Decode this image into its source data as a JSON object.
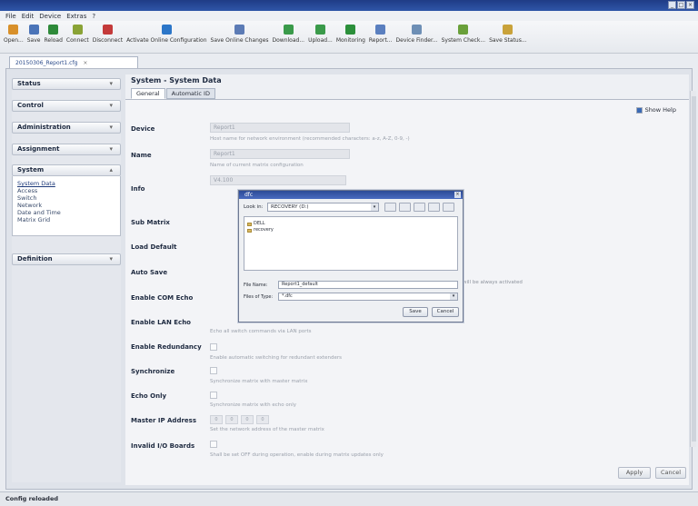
{
  "window": {
    "minimize": "_",
    "maximize": "□",
    "close": "×"
  },
  "menu": [
    "File",
    "Edit",
    "Device",
    "Extras",
    "?"
  ],
  "toolbar": [
    {
      "label": "Open...",
      "icon": "open-icon",
      "color": "#d8902a"
    },
    {
      "label": "Save",
      "icon": "save-icon",
      "color": "#4b74b8"
    },
    {
      "label": "Reload",
      "icon": "reload-icon",
      "color": "#2e8a3a"
    },
    {
      "label": "Connect",
      "icon": "connect-icon",
      "color": "#8aa336"
    },
    {
      "label": "Disconnect",
      "icon": "disconnect-icon",
      "color": "#c43a3a"
    },
    {
      "label": "Activate Online Configuration",
      "icon": "activate-icon",
      "color": "#2c76c8"
    },
    {
      "label": "Save Online Changes",
      "icon": "save-online-icon",
      "color": "#5c7bb5"
    },
    {
      "label": "Download...",
      "icon": "download-icon",
      "color": "#3a9a4a"
    },
    {
      "label": "Upload...",
      "icon": "upload-icon",
      "color": "#3a9a4a"
    },
    {
      "label": "Monitoring",
      "icon": "monitoring-icon",
      "color": "#2b8f3a"
    },
    {
      "label": "Report...",
      "icon": "report-icon",
      "color": "#5a7fbf"
    },
    {
      "label": "Device Finder...",
      "icon": "device-finder-icon",
      "color": "#6e8fb5"
    },
    {
      "label": "System Check...",
      "icon": "system-check-icon",
      "color": "#6aa03a"
    },
    {
      "label": "Save Status...",
      "icon": "save-status-icon",
      "color": "#c9a23a"
    }
  ],
  "file_tab": {
    "label": "20150306_Report1.cfg",
    "close": "×"
  },
  "sidebar": {
    "sections": [
      {
        "label": "Status",
        "chevron": "▾"
      },
      {
        "label": "Control",
        "chevron": "▾"
      },
      {
        "label": "Administration",
        "chevron": "▾"
      },
      {
        "label": "Assignment",
        "chevron": "▾"
      },
      {
        "label": "System",
        "chevron": "▴"
      },
      {
        "label": "Definition",
        "chevron": "▾"
      }
    ],
    "system_items": [
      "System Data",
      "Access",
      "Switch",
      "Network",
      "Date and Time",
      "Matrix Grid"
    ]
  },
  "main": {
    "title": "System - System Data",
    "tabs": [
      "General",
      "Automatic ID"
    ],
    "show_help": "Show Help"
  },
  "fields": {
    "device": {
      "label": "Device",
      "value": "Report1",
      "help": "Host name for network environment (recommended characters: a-z, A-Z, 0-9, -)"
    },
    "name": {
      "label": "Name",
      "value": "Report1",
      "help": "Name of current matrix configuration"
    },
    "info": {
      "label": "Info",
      "value": "V4.100"
    },
    "sub_matrix": {
      "label": "Sub Matrix"
    },
    "load_default": {
      "label": "Load Default"
    },
    "auto_save": {
      "label": "Auto Save"
    },
    "enable_com_echo": {
      "label": "Enable COM Echo"
    },
    "enable_lan_echo": {
      "label": "Enable LAN Echo",
      "help": "Echo all switch commands via LAN ports"
    },
    "enable_redundancy": {
      "label": "Enable Redundancy",
      "help": "Enable automatic switching for redundant extenders"
    },
    "synchronize": {
      "label": "Synchronize",
      "help": "Synchronize matrix with master matrix"
    },
    "echo_only": {
      "label": "Echo Only",
      "help": "Synchronize matrix with echo only"
    },
    "master_ip": {
      "label": "Master IP Address",
      "octets": [
        "0",
        "0",
        "0",
        "0"
      ],
      "help": "Set the network address of the master matrix"
    },
    "invalid_io": {
      "label": "Invalid I/O Boards",
      "help": "Shall be set OFF during operation, enable during matrix updates only"
    },
    "partial_note": "will be always activated"
  },
  "buttons": {
    "apply": "Apply",
    "cancel": "Cancel"
  },
  "status": "Config reloaded",
  "dialog": {
    "title": "dfc",
    "look_in_label": "Look in:",
    "look_in_value": "RECOVERY (D:)",
    "items": [
      "DELL",
      "recovery"
    ],
    "filename_label": "File Name:",
    "filename_value": "Report1_default",
    "filetype_label": "Files of Type:",
    "filetype_value": "*.dfc",
    "save": "Save",
    "cancel": "Cancel",
    "close": "×",
    "arrow": "▾"
  }
}
